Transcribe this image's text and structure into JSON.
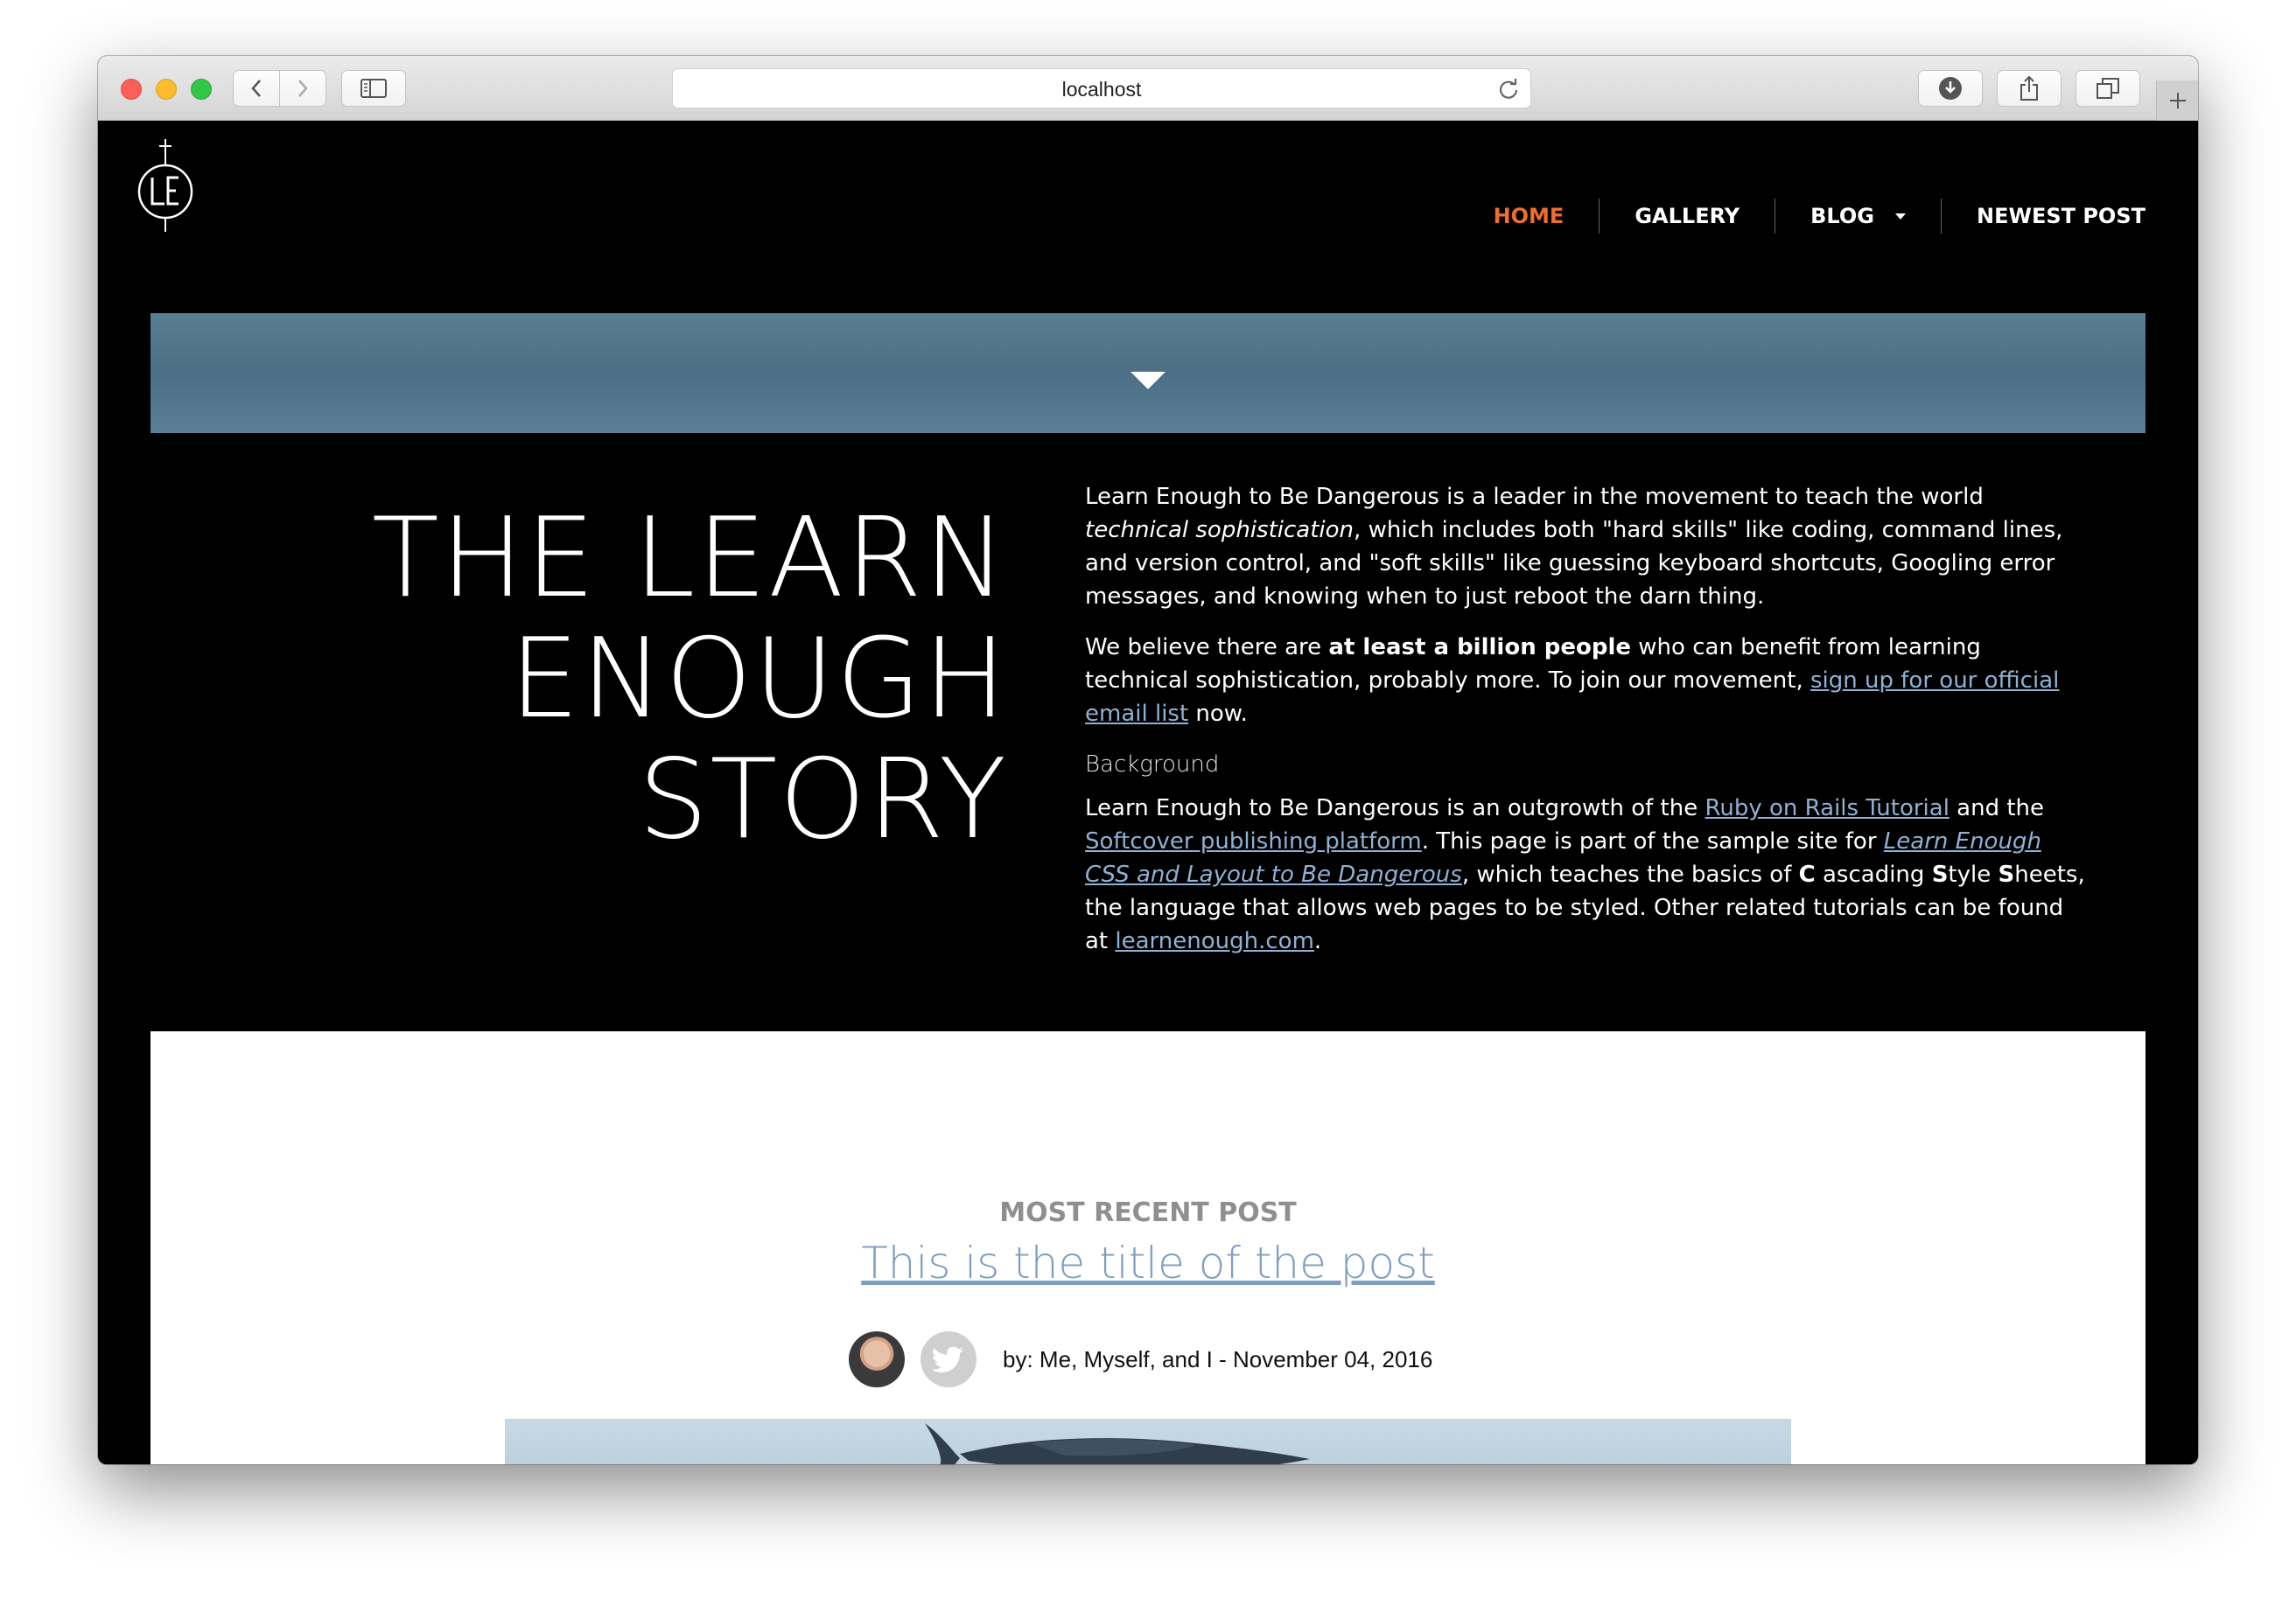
{
  "browser": {
    "url": "localhost"
  },
  "nav": {
    "items": [
      {
        "label": "HOME"
      },
      {
        "label": "GALLERY"
      },
      {
        "label": "BLOG"
      },
      {
        "label": "NEWEST POST"
      }
    ]
  },
  "hero": {
    "title_lines": [
      "THE LEARN",
      "ENOUGH",
      "STORY"
    ]
  },
  "story": {
    "p1_a": "Learn Enough to Be Dangerous is a leader in the movement to teach the world ",
    "p1_em": "technical sophistication",
    "p1_b": ", which includes both \"hard skills\" like coding, command lines, and version control, and \"soft skills\" like guessing keyboard shortcuts, Googling error messages, and knowing when to just reboot the darn thing.",
    "p2_a": "We believe there are ",
    "p2_strong": "at least a billion people",
    "p2_b": " who can benefit from learning technical sophistication, probably more. To join our movement, ",
    "p2_link": "sign up for our official email list",
    "p2_c": " now.",
    "background_heading": "Background",
    "p3_a": "Learn Enough to Be Dangerous is an outgrowth of the ",
    "p3_link1": "Ruby on Rails Tutorial",
    "p3_b": " and the ",
    "p3_link2": "Softcover publishing platform",
    "p3_c": ". This page is part of the sample site for ",
    "p3_link3": "Learn Enough CSS and Layout to Be Dangerous",
    "p3_d": ", which teaches the basics of ",
    "p3_C": "C",
    "p3_e": " ascading ",
    "p3_S1": "S",
    "p3_f": "tyle ",
    "p3_S2": "S",
    "p3_g": "heets, the language that allows web pages to be styled. Other related tutorials can be found at ",
    "p3_link4": "learnenough.com",
    "p3_h": "."
  },
  "recent_post": {
    "label": "MOST RECENT POST",
    "title": "This is the title of the post",
    "byline": "by: Me, Myself, and I - November 04, 2016"
  },
  "colors": {
    "accent": "#ed6e2f",
    "link": "#8fb1d3",
    "hero_band": "#52758c"
  }
}
